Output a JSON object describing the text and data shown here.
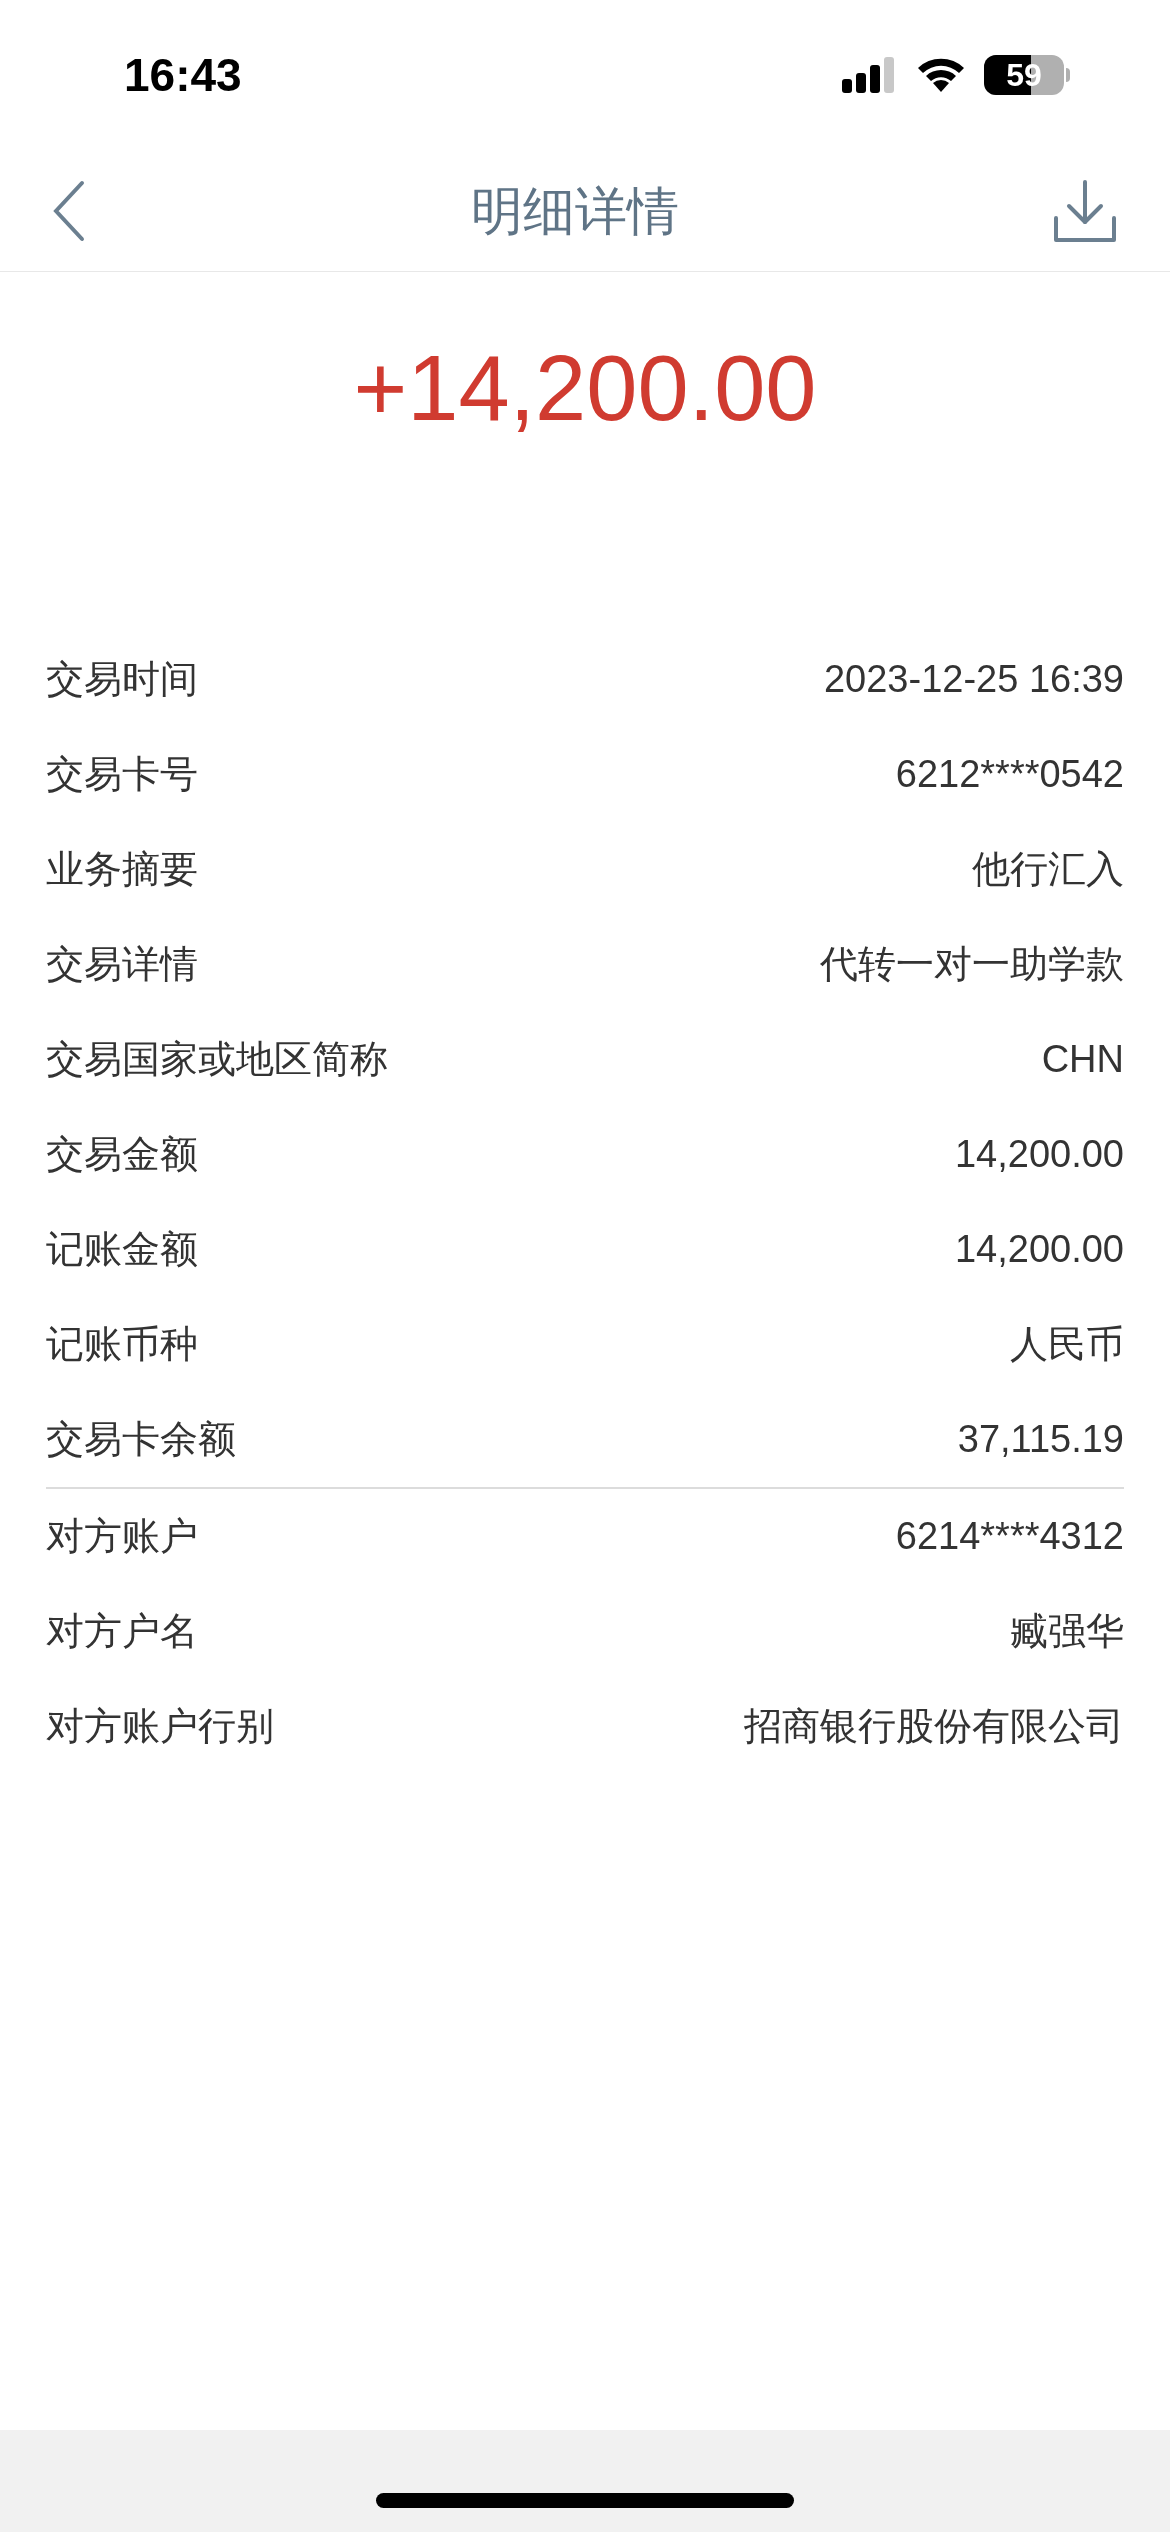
{
  "status_bar": {
    "time": "16:43",
    "battery": "59"
  },
  "header": {
    "title": "明细详情"
  },
  "amount": "+14,200.00",
  "details": [
    {
      "label": "交易时间",
      "value": "2023-12-25 16:39"
    },
    {
      "label": "交易卡号",
      "value": "6212****0542"
    },
    {
      "label": "业务摘要",
      "value": "他行汇入"
    },
    {
      "label": "交易详情",
      "value": "代转一对一助学款"
    },
    {
      "label": "交易国家或地区简称",
      "value": "CHN"
    },
    {
      "label": "交易金额",
      "value": "14,200.00"
    },
    {
      "label": "记账金额",
      "value": "14,200.00"
    },
    {
      "label": "记账币种",
      "value": "人民币"
    },
    {
      "label": "交易卡余额",
      "value": "37,115.19"
    }
  ],
  "counterparty": [
    {
      "label": "对方账户",
      "value": "6214****4312"
    },
    {
      "label": "对方户名",
      "value": "臧强华"
    },
    {
      "label": "对方账户行别",
      "value": "招商银行股份有限公司"
    }
  ]
}
